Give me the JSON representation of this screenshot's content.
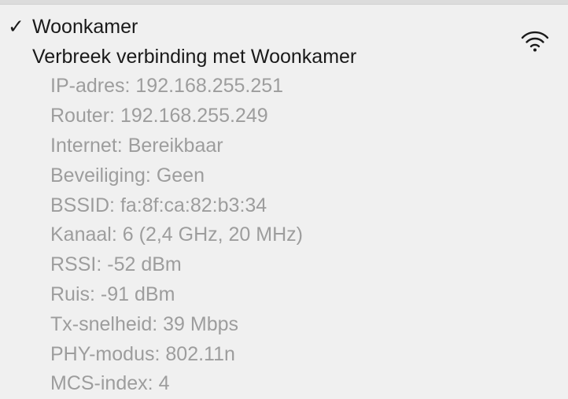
{
  "network": {
    "checkmark": "✓",
    "name": "Woonkamer",
    "icon": "wifi-icon",
    "disconnect_label": "Verbreek verbinding met Woonkamer"
  },
  "details": [
    {
      "label": "IP-adres",
      "value": "192.168.255.251"
    },
    {
      "label": "Router",
      "value": "192.168.255.249"
    },
    {
      "label": "Internet",
      "value": "Bereikbaar"
    },
    {
      "label": "Beveiliging",
      "value": "Geen"
    },
    {
      "label": "BSSID",
      "value": "fa:8f:ca:82:b3:34"
    },
    {
      "label": "Kanaal",
      "value": "6 (2,4 GHz, 20 MHz)"
    },
    {
      "label": "RSSI",
      "value": "-52 dBm"
    },
    {
      "label": "Ruis",
      "value": "-91 dBm"
    },
    {
      "label": "Tx-snelheid",
      "value": "39 Mbps"
    },
    {
      "label": "PHY-modus",
      "value": "802.11n"
    },
    {
      "label": "MCS-index",
      "value": "4"
    }
  ],
  "colors": {
    "background": "#f0f0f0",
    "primary_text": "#1a1a1a",
    "disabled_text": "#9d9d9d"
  }
}
